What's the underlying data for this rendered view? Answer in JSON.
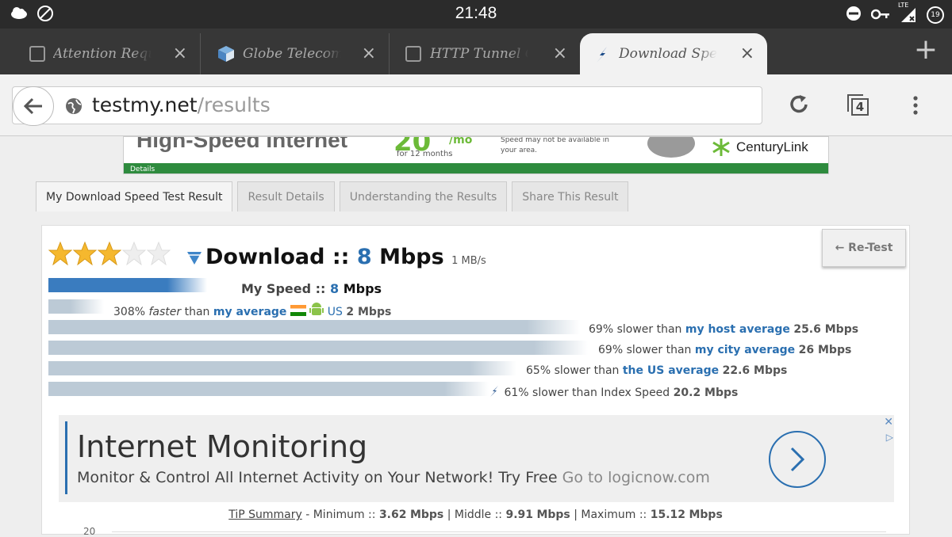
{
  "status": {
    "time": "21:48",
    "battery": "19",
    "network": "LTE"
  },
  "tabs": [
    {
      "title": "Attention Requir"
    },
    {
      "title": "Globe Telecom &"
    },
    {
      "title": "HTTP Tunnel G"
    },
    {
      "title": "Download Speed Te"
    }
  ],
  "address": {
    "host": "testmy.net",
    "path": "/results"
  },
  "tab_count": "4",
  "banner": {
    "headline": "High-Speed Internet",
    "price": "20",
    "per": "/mo",
    "term": "for 12 months",
    "fine": "Speed may not be available in your area.",
    "brand": "CenturyLink",
    "details": "Details"
  },
  "result_tabs": [
    "My Download Speed Test Result",
    "Result Details",
    "Understanding the Results",
    "Share This Result"
  ],
  "result": {
    "rating_stars": 3,
    "title_prefix": "Download ::",
    "speed": "8",
    "unit": "Mbps",
    "mbytes": "1 MB/s",
    "retest": "← Re-Test",
    "my_speed_label": "My Speed ::",
    "my_speed_value": "8",
    "my_speed_unit": "Mbps"
  },
  "comparisons": [
    {
      "pct": "308%",
      "word": "faster",
      "text": "than",
      "link": "my average",
      "suffix": "US",
      "value": "2 Mbps"
    },
    {
      "text": "69% slower than",
      "link": "my host average",
      "value": "25.6 Mbps"
    },
    {
      "text": "69% slower than",
      "link": "my city average",
      "value": "26 Mbps"
    },
    {
      "text": "65% slower than",
      "link": "the US average",
      "value": "22.6 Mbps"
    },
    {
      "text": "61% slower than Index Speed",
      "link": "",
      "value": "20.2 Mbps"
    }
  ],
  "ad": {
    "headline": "Internet Monitoring",
    "sub": "Monitor & Control All Internet Activity on Your Network! Try Free",
    "link": "Go to logicnow.com"
  },
  "tip": {
    "label": "TiP Summary",
    "min_label": "- Minimum ::",
    "min": "3.62",
    "min_unit": "Mbps",
    "mid_label": "| Middle ::",
    "mid": "9.91",
    "mid_unit": "Mbps",
    "max_label": "| Maximum ::",
    "max": "15.12",
    "max_unit": "Mbps"
  },
  "chart_ytick": "20",
  "colors": {
    "accent": "#2a6fb0",
    "bar": "#bccad6",
    "mybar": "#3a7cbf"
  }
}
